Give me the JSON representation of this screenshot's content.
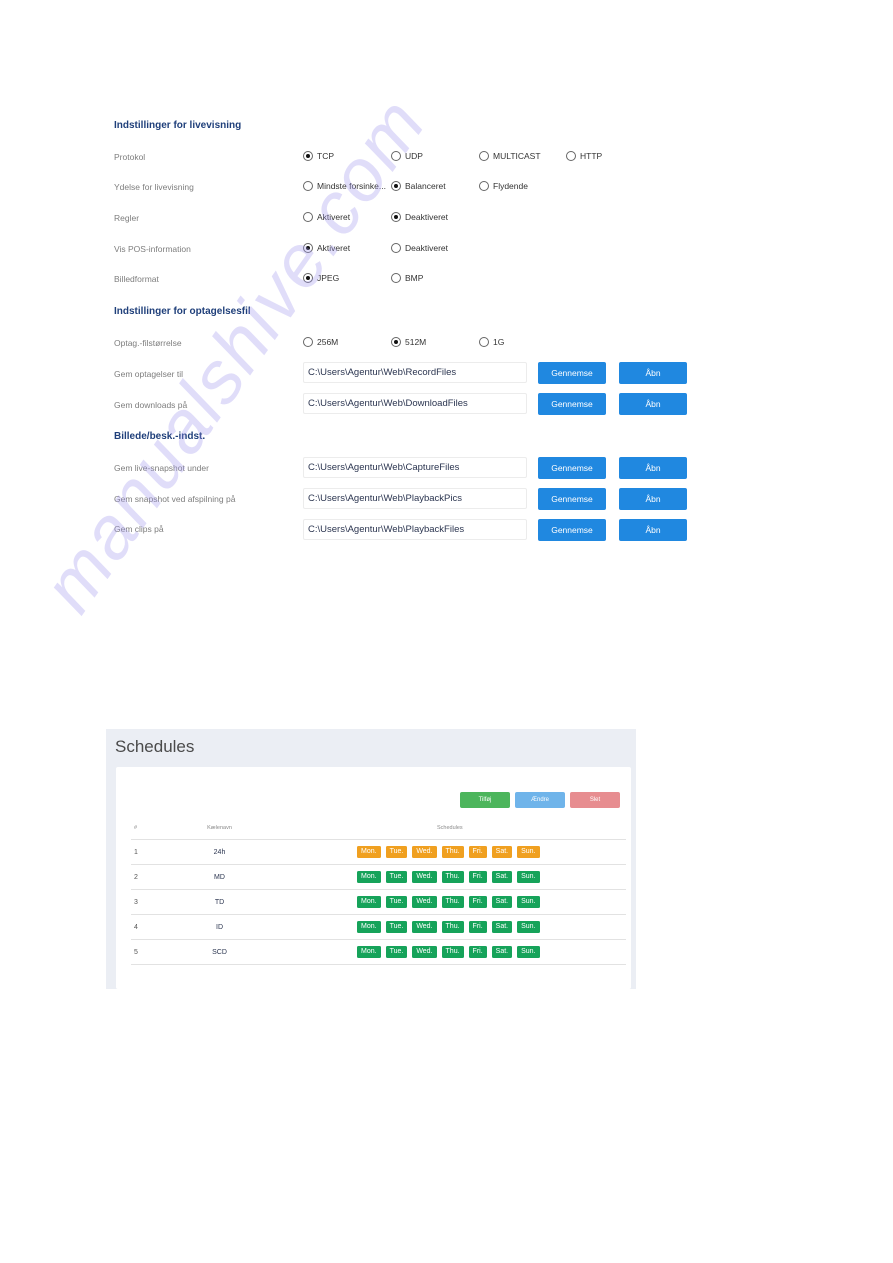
{
  "settings": {
    "live_view": {
      "title": "Indstillinger for livevisning",
      "rows": [
        {
          "label": "Protokol",
          "options": [
            "TCP",
            "UDP",
            "MULTICAST",
            "HTTP"
          ],
          "selected": "TCP"
        },
        {
          "label": "Ydelse for livevisning",
          "options": [
            "Mindste forsinke...",
            "Balanceret",
            "Flydende"
          ],
          "selected": "Balanceret"
        },
        {
          "label": "Regler",
          "options": [
            "Aktiveret",
            "Deaktiveret"
          ],
          "selected": "Deaktiveret"
        },
        {
          "label": "Vis POS-information",
          "options": [
            "Aktiveret",
            "Deaktiveret"
          ],
          "selected": "Aktiveret"
        },
        {
          "label": "Billedformat",
          "options": [
            "JPEG",
            "BMP"
          ],
          "selected": "JPEG"
        }
      ]
    },
    "record_file": {
      "title": "Indstillinger for optagelsesfil",
      "size_row": {
        "label": "Optag.-filstørrelse",
        "options": [
          "256M",
          "512M",
          "1G"
        ],
        "selected": "512M"
      },
      "path_rows": [
        {
          "label": "Gem optagelser til",
          "value": "C:\\Users\\Agentur\\Web\\RecordFiles"
        },
        {
          "label": "Gem downloads på",
          "value": "C:\\Users\\Agentur\\Web\\DownloadFiles"
        }
      ]
    },
    "picture": {
      "title": "Billede/besk.-indst.",
      "path_rows": [
        {
          "label": "Gem live-snapshot under",
          "value": "C:\\Users\\Agentur\\Web\\CaptureFiles"
        },
        {
          "label": "Gem snapshot ved afspilning på",
          "value": "C:\\Users\\Agentur\\Web\\PlaybackPics"
        },
        {
          "label": "Gem clips på",
          "value": "C:\\Users\\Agentur\\Web\\PlaybackFiles"
        }
      ]
    },
    "buttons": {
      "browse": "Gennemse",
      "open": "Åbn"
    }
  },
  "schedules": {
    "title": "Schedules",
    "actions": {
      "add": "Tilføj",
      "edit": "Ændre",
      "delete": "Slet"
    },
    "columns": [
      "#",
      "Kælenavn",
      "Schedules"
    ],
    "days": [
      "Mon.",
      "Tue.",
      "Wed.",
      "Thu.",
      "Fri.",
      "Sat.",
      "Sun."
    ],
    "rows": [
      {
        "num": "1",
        "name": "24h",
        "color": "#f0a020"
      },
      {
        "num": "2",
        "name": "MD",
        "color": "#16a35a"
      },
      {
        "num": "3",
        "name": "TD",
        "color": "#16a35a"
      },
      {
        "num": "4",
        "name": "ID",
        "color": "#16a35a"
      },
      {
        "num": "5",
        "name": "SCD",
        "color": "#16a35a"
      }
    ]
  },
  "watermark": "manualshive.com",
  "colors": {
    "heading": "#1f3f7a",
    "primary_button": "#2088e0",
    "add_button": "#4cb55c",
    "edit_button": "#6fb4ea",
    "delete_button": "#e78d90",
    "schedule_24h": "#f0a020",
    "schedule_default": "#16a35a"
  }
}
